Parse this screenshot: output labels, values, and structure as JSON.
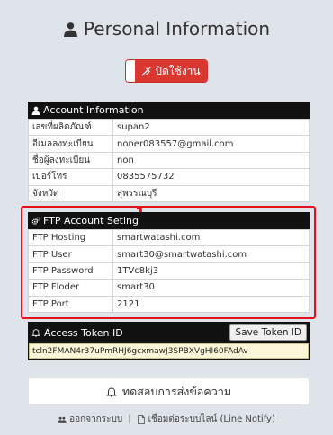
{
  "title": "Personal Information",
  "toggle": {
    "label": "ปิดใช้งาน"
  },
  "account": {
    "header": "Account Information",
    "rows": [
      {
        "label": "เลขที่ผลิตภัณฑ์",
        "value": "supan2"
      },
      {
        "label": "อีเมลลงทะเบียน",
        "value": "noner083557@gmail.com"
      },
      {
        "label": "ชื่อผู้ลงทะเบียน",
        "value": "non"
      },
      {
        "label": "เบอร์โทร",
        "value": "0835575732"
      },
      {
        "label": "จังหวัด",
        "value": "สุพรรณบุรี"
      }
    ]
  },
  "annotation": {
    "number": "1",
    "color": "#e3121a"
  },
  "ftp": {
    "header": "FTP Account Seting",
    "rows": [
      {
        "label": "FTP Hosting",
        "value": "smartwatashi.com"
      },
      {
        "label": "FTP User",
        "value": "smart30@smartwatashi.com"
      },
      {
        "label": "FTP Password",
        "value": "1TVc8kj3"
      },
      {
        "label": "FTP Floder",
        "value": "smart30"
      },
      {
        "label": "FTP Port",
        "value": "2121"
      }
    ]
  },
  "token": {
    "header": "Access Token ID",
    "save_label": "Save Token ID",
    "value": "tcln2FMAN4r37uPmRHJ6gcxmawJ3SPBXVgHI60FAdAv"
  },
  "test_button": {
    "label": "ทดสอบการส่งข้อความ"
  },
  "footer": {
    "logout": "ออกจากระบบ",
    "separator": "|",
    "connect": "เชื่อมต่อระบบไลน์ (Line Notify)"
  },
  "colors": {
    "danger": "#d9372f",
    "highlight": "#e3121a",
    "dark": "#111111"
  },
  "icons": [
    "user-icon",
    "slash-icon",
    "cogs-icon",
    "bell-icon",
    "users-icon",
    "file-icon"
  ]
}
